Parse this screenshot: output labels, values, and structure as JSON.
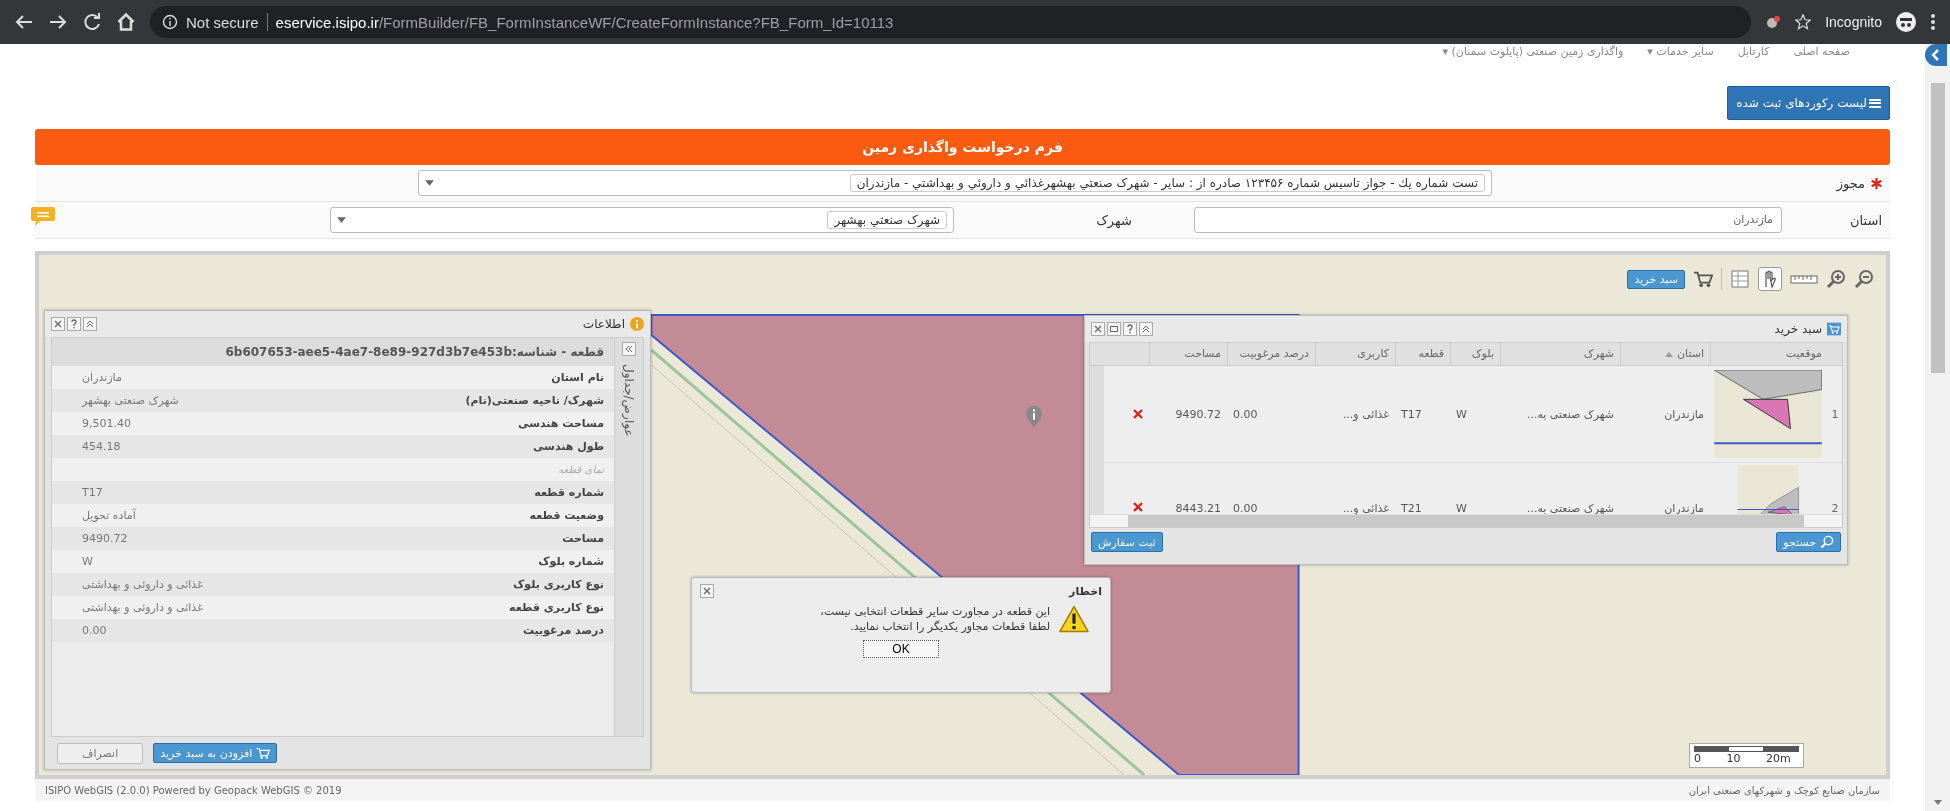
{
  "browser": {
    "security": "Not secure",
    "host": "eservice.isipo.ir",
    "path": "/FormBuilder/FB_FormInstanceWF/CreateFormInstance?FB_Form_Id=10113",
    "profile": "Incognito"
  },
  "nav": [
    "صفحه اصلی",
    "کارتابل",
    "سایر خدمات ▾",
    "واگذاری زمین صنعتی (پایلوت سمنان) ▾"
  ],
  "records_button": "لیست رکوردهای ثبت شده",
  "form": {
    "title": "فرم درخواست واگذاری زمین",
    "license": {
      "label": "مجوز",
      "required": true,
      "value": "تست شماره يك - جواز تاسيس شماره ۱۲۳۴۵۶ صادره از : ساير - شهرک صنعتي بهشهرغذائي و داروئي و بهداشتي - مازندران"
    },
    "province": {
      "label": "استان",
      "value": "مازندران"
    },
    "town": {
      "label": "شهرک",
      "value": "شهرک صنعتي بهشهر"
    }
  },
  "map": {
    "cart_button": "سبد خرید",
    "scale": "0 10 20m"
  },
  "info_panel": {
    "title": "اطلاعات",
    "side_tab": "عوارض/جداول",
    "header": "قطعه - شناسه:6b607653-aee5-4ae7-8e89-927d3b7e453b",
    "rows": [
      {
        "kind": "field",
        "label": "نام استان",
        "value": "مازندران"
      },
      {
        "kind": "field",
        "label": "شهرک/ ناحیه صنعتی(نام)",
        "value": "شهرک صنعتی بهشهر"
      },
      {
        "kind": "field",
        "label": "مساحت هندسی",
        "value": "9,501.40"
      },
      {
        "kind": "field",
        "label": "طول هندسی",
        "value": "454.18"
      },
      {
        "kind": "section",
        "label": "نمای قطعه"
      },
      {
        "kind": "field",
        "label": "شماره قطعه",
        "value": "T17"
      },
      {
        "kind": "field",
        "label": "وضعیت قطعه",
        "value": "آماده تحویل"
      },
      {
        "kind": "field",
        "label": "مساحت",
        "value": "9490.72"
      },
      {
        "kind": "field",
        "label": "شماره بلوک",
        "value": "W"
      },
      {
        "kind": "field",
        "label": "نوع کاربری بلوک",
        "value": "غذائی و داروئی و بهداشتی"
      },
      {
        "kind": "field",
        "label": "نوع کاربری قطعه",
        "value": "غذائی و داروئی و بهداشتی"
      },
      {
        "kind": "field",
        "label": "درصد مرغوبیت",
        "value": "0.00"
      }
    ],
    "add_button": "افزودن به سبد خرید",
    "cancel_button": "انصراف"
  },
  "cart": {
    "title": "سبد خرید",
    "columns": [
      {
        "label": "موقعیت",
        "sorted": false
      },
      {
        "label": "استان",
        "sorted": true
      },
      {
        "label": "شهرک",
        "sorted": false
      },
      {
        "label": "بلوک",
        "sorted": false
      },
      {
        "label": "قطعه",
        "sorted": false
      },
      {
        "label": "کاربری",
        "sorted": false
      },
      {
        "label": "درصد مرغوبیت",
        "sorted": false
      },
      {
        "label": "مساحت",
        "sorted": false
      }
    ],
    "rows": [
      {
        "index": "1",
        "province": "مازندران",
        "town": "شهرک صنعتی به...",
        "block": "W",
        "parcel": "T17",
        "use": "غذائی و...",
        "quality": "0.00",
        "area": "9490.72"
      },
      {
        "index": "2",
        "province": "مازندران",
        "town": "شهرک صنعتی به...",
        "block": "W",
        "parcel": "T21",
        "use": "غذائی و...",
        "quality": "0.00",
        "area": "8443.21"
      }
    ],
    "search_button": "جستجو",
    "order_button": "ثبت سفارش"
  },
  "dialog": {
    "title": "اخطار",
    "message": "این قطعه در مجاورت سایر قطعات انتخابی نیست، لطفا قطعات مجاور یکدیگر را انتخاب نمایید.",
    "ok": "OK"
  },
  "footer": {
    "left": "ISIPO WebGIS (2.0.0) Powered by  Geopack WebGIS  © 2019",
    "right": "سازمان صنایع کوچک و شهرکهای صنعتی ایران"
  }
}
